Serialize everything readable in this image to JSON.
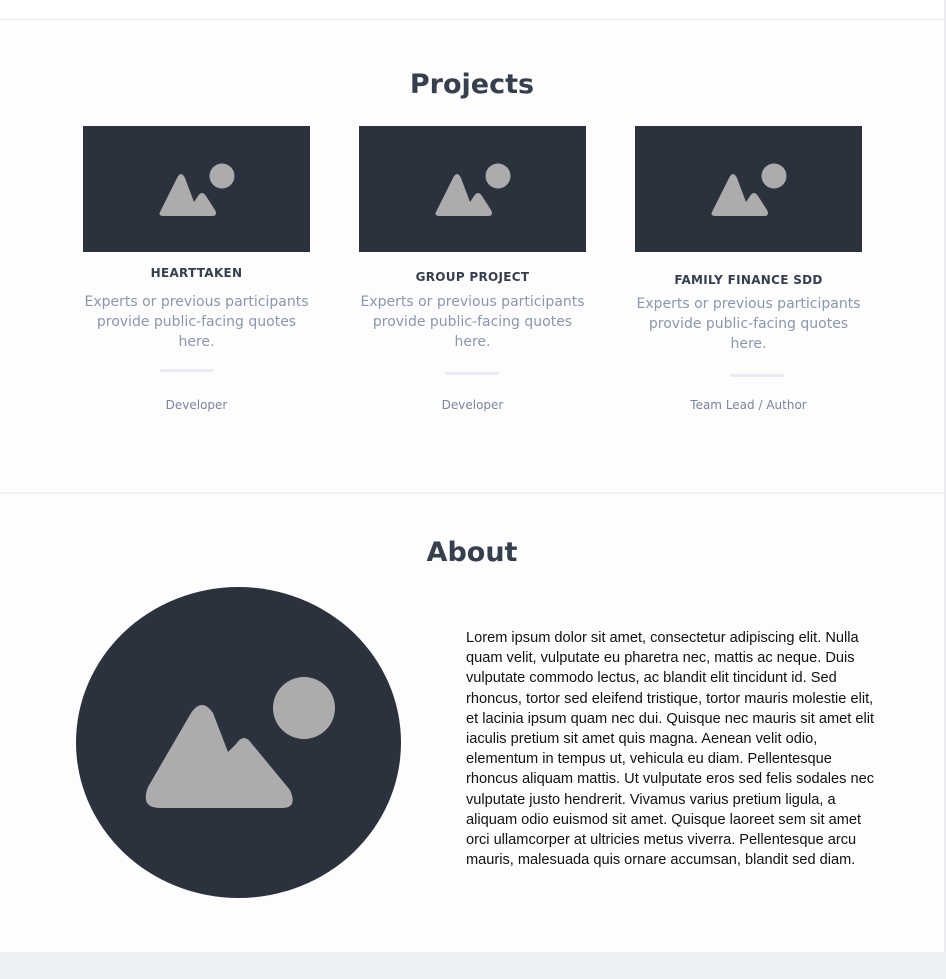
{
  "projects": {
    "title": "Projects",
    "cards": [
      {
        "title": "HEARTTAKEN",
        "description_lines": [
          "Experts or previous participants",
          "provide public-facing quotes",
          "here."
        ],
        "role": "Developer",
        "image_icon": "image-placeholder-icon"
      },
      {
        "title": "GROUP PROJECT",
        "description_lines": [
          "Experts or previous participants",
          "provide public-facing quotes",
          "here."
        ],
        "role": "Developer",
        "image_icon": "image-placeholder-icon"
      },
      {
        "title": "FAMILY FINANCE SDD",
        "description_lines": [
          "Experts or previous participants",
          "provide public-facing quotes",
          "here."
        ],
        "role": "Team Lead / Author",
        "image_icon": "image-placeholder-icon"
      }
    ]
  },
  "about": {
    "title": "About",
    "avatar_icon": "image-placeholder-icon",
    "text_lines": [
      "Lorem ipsum dolor sit amet, consectetur adipiscing elit. Nulla",
      "quam velit, vulputate eu pharetra nec, mattis ac neque. Duis",
      "vulputate commodo lectus, ac blandit elit tincidunt id. Sed",
      "rhoncus, tortor sed eleifend tristique, tortor mauris molestie elit,",
      "et lacinia ipsum quam nec dui. Quisque nec mauris sit amet elit",
      "iaculis pretium sit amet quis magna. Aenean velit odio,",
      "elementum in tempus ut, vehicula eu diam. Pellentesque",
      "rhoncus aliquam mattis. Ut vulputate eros sed felis sodales nec",
      "vulputate justo hendrerit. Vivamus varius pretium ligula, a",
      "aliquam odio euismod sit amet. Quisque laoreet sem sit amet",
      "orci ullamcorper at ultricies metus viverra. Pellentesque arcu",
      "mauris, malesuada quis ornare accumsan, blandit sed diam."
    ]
  },
  "colors": {
    "heading": "#363f4e",
    "image_bg": "#2b313d",
    "placeholder_shape": "#acacac",
    "muted_text": "#8a97ad"
  }
}
